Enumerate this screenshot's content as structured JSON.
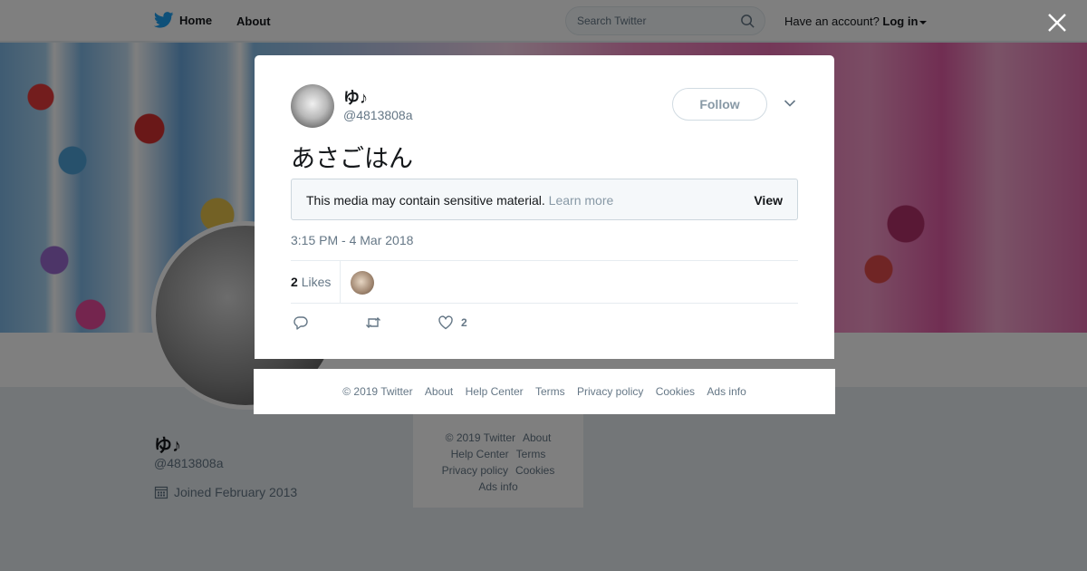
{
  "topbar": {
    "home_label": "Home",
    "about_label": "About",
    "search_placeholder": "Search Twitter",
    "account_prompt": "Have an account?",
    "login_label": "Log in"
  },
  "profile": {
    "name": "ゆ♪",
    "handle": "@4813808a",
    "joined": "Joined February 2013"
  },
  "side_footer": {
    "links": [
      "© 2019 Twitter",
      "About",
      "Help Center",
      "Terms",
      "Privacy policy",
      "Cookies",
      "Ads info"
    ]
  },
  "tweet": {
    "author_name": "ゆ♪",
    "author_handle": "@4813808a",
    "follow_label": "Follow",
    "text": "あさごはん",
    "sensitive_message": "This media may contain sensitive material.",
    "learn_more": "Learn more",
    "view_label": "View",
    "timestamp": "3:15 PM - 4 Mar 2018",
    "likes_count": "2",
    "likes_label": "Likes",
    "like_action_count": "2"
  },
  "modal_footer": {
    "links": [
      "© 2019 Twitter",
      "About",
      "Help Center",
      "Terms",
      "Privacy policy",
      "Cookies",
      "Ads info"
    ]
  },
  "colors": {
    "twitter_blue": "#1da1f2",
    "text_secondary": "#657786",
    "overlay": "rgba(0,0,0,0.5)"
  },
  "icons": [
    "twitter-bird-icon",
    "search-icon",
    "caret-down-icon",
    "close-icon",
    "chevron-down-icon",
    "reply-icon",
    "retweet-icon",
    "heart-icon",
    "calendar-icon"
  ]
}
